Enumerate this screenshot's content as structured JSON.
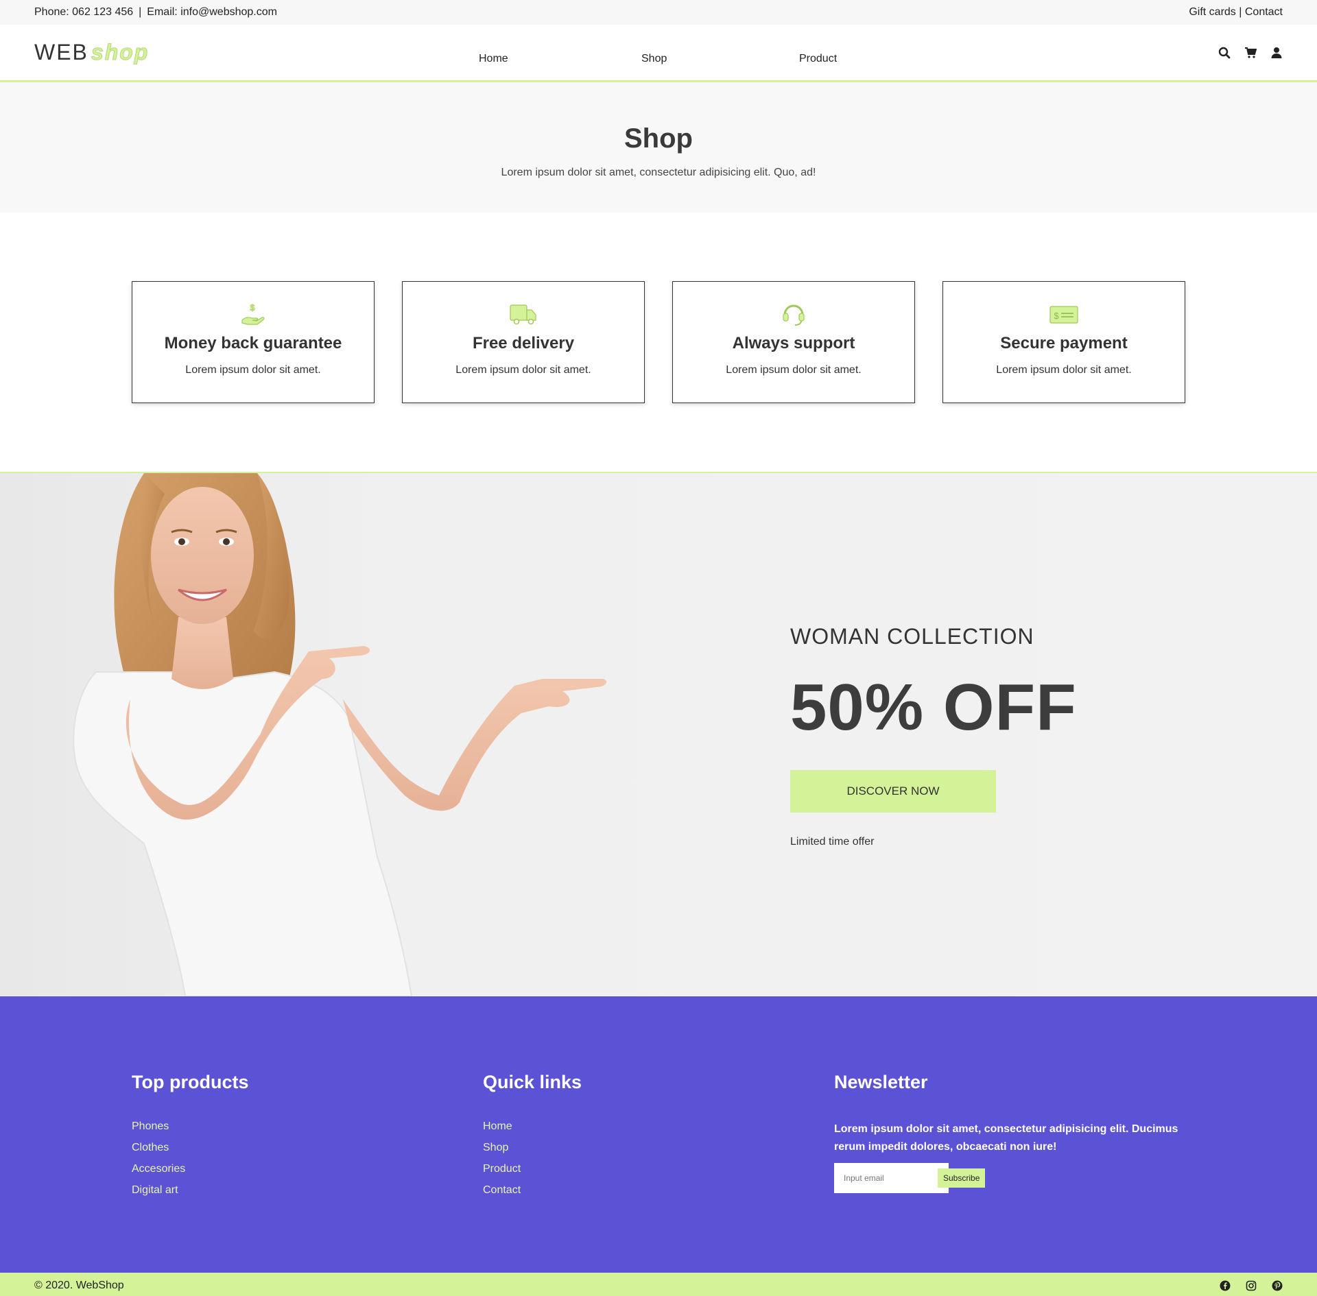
{
  "topbar": {
    "phone": "Phone: 062 123 456",
    "separator": "|",
    "email": "Email: info@webshop.com",
    "gift_cards": "Gift cards",
    "divider": "|",
    "contact": "Contact"
  },
  "header": {
    "logo_web": "WEB",
    "logo_shop": "shop",
    "nav": [
      "Home",
      "Shop",
      "Product"
    ],
    "icons": [
      "search-icon",
      "cart-icon",
      "user-icon"
    ]
  },
  "page_hero": {
    "title": "Shop",
    "subtitle": "Lorem ipsum dolor sit amet, consectetur adipisicing elit. Quo, ad!"
  },
  "features": [
    {
      "icon": "money-hand-icon",
      "title": "Money back guarantee",
      "text": "Lorem ipsum dolor sit amet."
    },
    {
      "icon": "truck-icon",
      "title": "Free delivery",
      "text": "Lorem ipsum dolor sit amet."
    },
    {
      "icon": "headset-icon",
      "title": "Always support",
      "text": "Lorem ipsum dolor sit amet."
    },
    {
      "icon": "payment-card-icon",
      "title": "Secure payment",
      "text": "Lorem ipsum dolor sit amet."
    }
  ],
  "promo": {
    "collection": "WOMAN COLLECTION",
    "discount": "50% OFF",
    "button": "DISCOVER NOW",
    "note": "Limited time offer"
  },
  "footer": {
    "top_products": {
      "title": "Top products",
      "links": [
        "Phones",
        "Clothes",
        "Accesories",
        "Digital art"
      ]
    },
    "quick_links": {
      "title": "Quick links",
      "links": [
        "Home",
        "Shop",
        "Product",
        "Contact"
      ]
    },
    "newsletter": {
      "title": "Newsletter",
      "text": "Lorem ipsum dolor sit amet, consectetur adipisicing elit. Ducimus rerum impedit dolores, obcaecati non iure!",
      "placeholder": "Input email",
      "button": "Subscribe"
    }
  },
  "bottombar": {
    "copyright": "© 2020. WebShop",
    "social": [
      "facebook-icon",
      "instagram-icon",
      "pinterest-icon"
    ]
  },
  "colors": {
    "accent": "#d4f297",
    "footer_bg": "#5c52d6",
    "link": "#e2f7a8",
    "text": "#333333"
  }
}
